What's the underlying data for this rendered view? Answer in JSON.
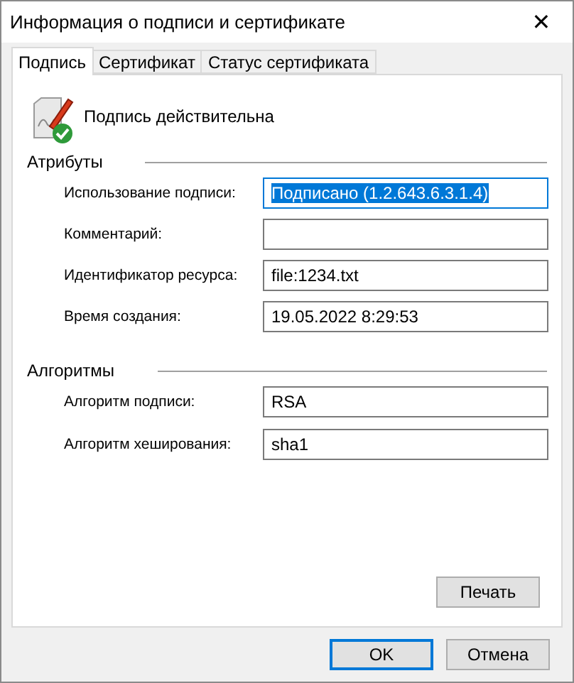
{
  "window": {
    "title": "Информация о подписи и сертификате",
    "close": "✕"
  },
  "tabs": [
    {
      "label": "Подпись",
      "selected": true
    },
    {
      "label": "Сертификат",
      "selected": false
    },
    {
      "label": "Статус сертификата",
      "selected": false
    }
  ],
  "status": "Подпись действительна",
  "sections": [
    {
      "title": "Атрибуты",
      "fields": [
        {
          "label": "Использование подписи:",
          "value": "Подписано (1.2.643.6.3.1.4)",
          "focused": true
        },
        {
          "label": "Комментарий:",
          "focused": false
        },
        {
          "label": "Идентификатор ресурса:",
          "value": "file:1234.txt",
          "focused": false
        },
        {
          "label": "Время создания:",
          "value": "19.05.2022 8:29:53",
          "focused": false
        }
      ]
    },
    {
      "title": "Алгоритмы",
      "fields": [
        {
          "label": "Алгоритм подписи:",
          "value": "RSA",
          "focused": false
        },
        {
          "label": "Алгоритм хеширования:",
          "value": "sha1",
          "focused": false
        }
      ]
    }
  ],
  "print_button": "Печать",
  "buttons": [
    {
      "label": "OK",
      "default": true
    },
    {
      "label": "Отмена",
      "default": false
    }
  ]
}
